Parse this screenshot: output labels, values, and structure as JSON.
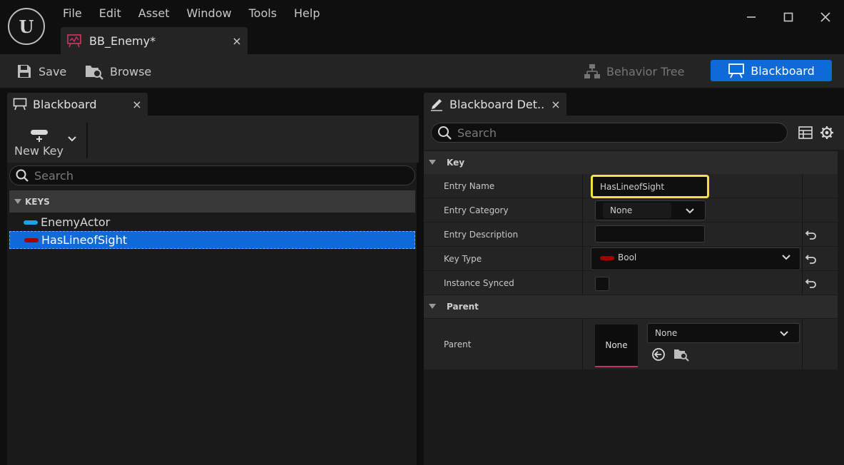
{
  "app": {
    "logo_text": "U"
  },
  "menu": [
    "File",
    "Edit",
    "Asset",
    "Window",
    "Tools",
    "Help"
  ],
  "window_controls": {
    "minimize_icon": "minimize-icon",
    "maximize_icon": "maximize-icon",
    "close_icon": "close-icon"
  },
  "document_tab": {
    "label": "BB_Enemy*",
    "close": "×"
  },
  "toolbar": {
    "save_label": "Save",
    "browse_label": "Browse",
    "behavior_tree_label": "Behavior Tree",
    "blackboard_label": "Blackboard"
  },
  "left_panel": {
    "tab_label": "Blackboard",
    "close": "×",
    "new_key_label": "New Key",
    "search_placeholder": "Search",
    "keys_header": "KEYS",
    "keys": [
      {
        "name": "EnemyActor",
        "color": "#1aa3e6"
      },
      {
        "name": "HasLineofSight",
        "color": "#a30000",
        "selected": true
      }
    ]
  },
  "right_panel": {
    "tab_label": "Blackboard Det...",
    "close": "×",
    "search_placeholder": "Search",
    "sections": {
      "key": {
        "header": "Key",
        "entry_name_label": "Entry Name",
        "entry_name_value": "HasLineofSight",
        "entry_category_label": "Entry Category",
        "entry_category_value": "None",
        "entry_description_label": "Entry Description",
        "entry_description_value": "",
        "key_type_label": "Key Type",
        "key_type_value": "Bool",
        "instance_synced_label": "Instance Synced",
        "instance_synced_checked": false
      },
      "parent": {
        "header": "Parent",
        "parent_label": "Parent",
        "thumb_label": "None",
        "combo_value": "None"
      }
    }
  },
  "colors": {
    "accent": "#0f6ad8",
    "highlight": "#f5e13a",
    "bool_pin": "#a30000",
    "object_pin": "#1aa3e6"
  }
}
